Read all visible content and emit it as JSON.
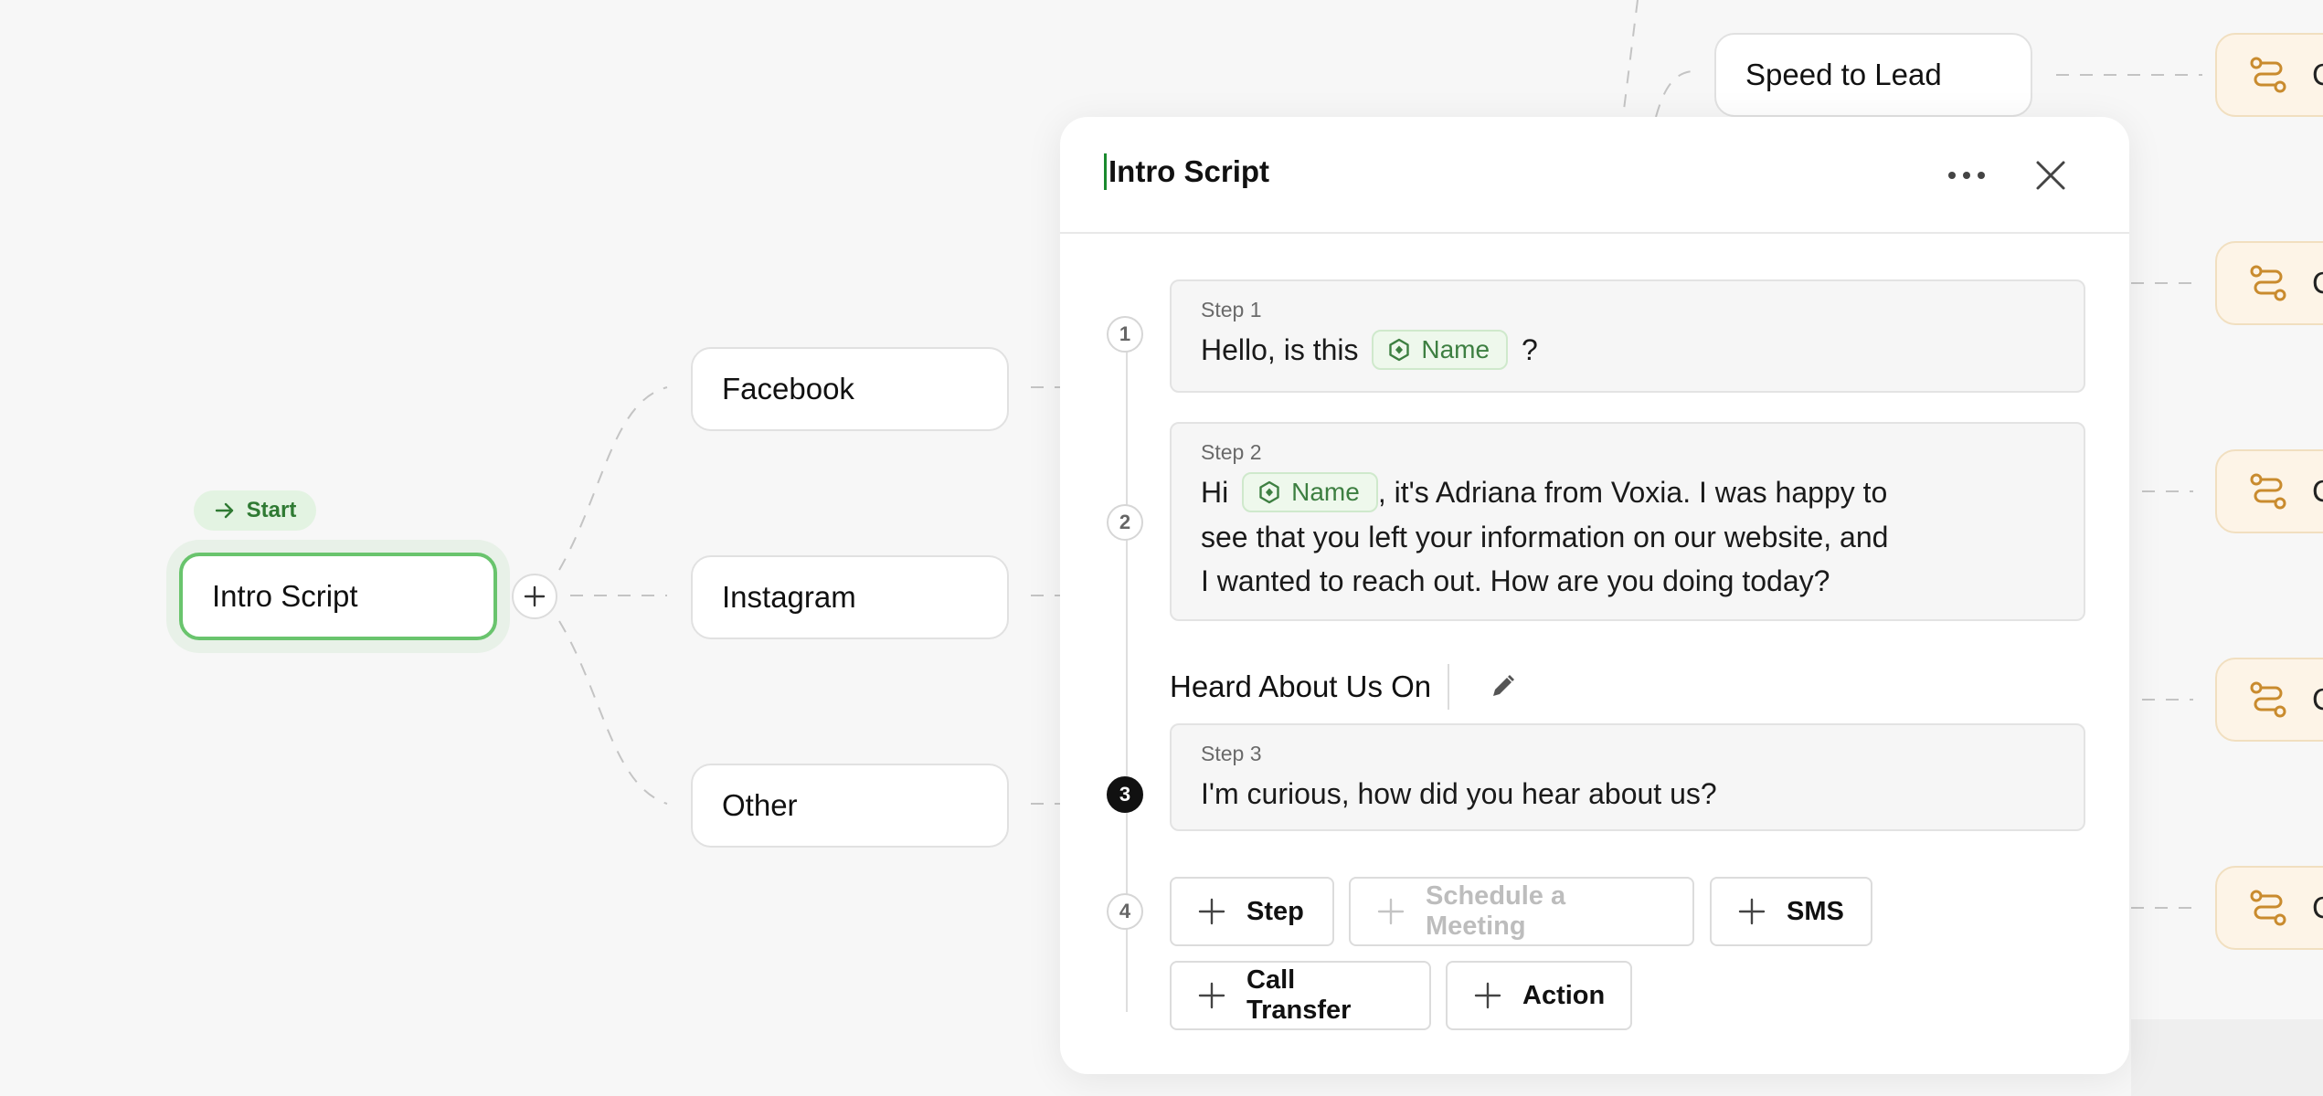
{
  "canvas": {
    "start_badge": "Start",
    "nodes": {
      "intro_script": "Intro Script",
      "facebook": "Facebook",
      "instagram": "Instagram",
      "other": "Other",
      "speed_to_lead": "Speed to Lead"
    },
    "right_nodes": [
      "C",
      "C",
      "C",
      "C",
      "C"
    ]
  },
  "modal": {
    "title": "Intro Script",
    "steps": [
      {
        "number": "1",
        "label": "Step 1",
        "text_before": "Hello, is this",
        "variable": "Name",
        "text_after": "?"
      },
      {
        "number": "2",
        "label": "Step 2",
        "text_before": "Hi",
        "variable": "Name",
        "text_line1_after": ", it's Adriana from Voxia. I was happy to",
        "text_line2": "see that you left your information on our website, and",
        "text_line3": "I wanted to reach out. How are you doing today?"
      },
      {
        "number": "3",
        "label": "Step 3",
        "text": "I'm curious, how did you hear about us?"
      }
    ],
    "section_label": "Heard About Us On",
    "add_step_number": "4",
    "add_buttons": {
      "step": "Step",
      "schedule": "Schedule a Meeting",
      "sms": "SMS",
      "call_transfer": "Call Transfer",
      "action": "Action"
    }
  },
  "colors": {
    "accent_green": "#69c46d",
    "chip_green": "#3d7f41",
    "orange_node": "#fdf4e7",
    "orange_icon": "#c98b2e"
  }
}
